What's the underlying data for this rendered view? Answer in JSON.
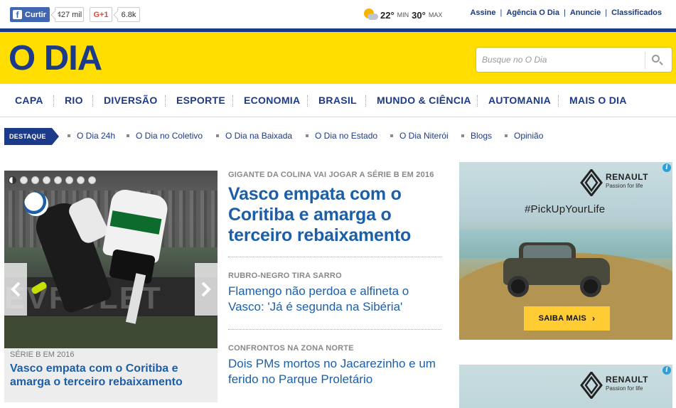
{
  "social": {
    "facebook_label": "Curtir",
    "facebook_count": "427 mil",
    "gplus_label": "G+1",
    "gplus_count": "6.8k"
  },
  "weather": {
    "icon": "partly-cloudy-icon",
    "min_temp": "22°",
    "min_label": "MIN",
    "max_temp": "30°",
    "max_label": "MAX"
  },
  "top_links": [
    "Assine",
    "Agência O Dia",
    "Anuncie",
    "Classificados"
  ],
  "brand": {
    "logo_text": "O DIA",
    "colors": {
      "yellow": "#ffde00",
      "navy": "#1c3a8a",
      "link_blue": "#1c5fa8"
    }
  },
  "search": {
    "placeholder": "Busque no O Dia",
    "value": ""
  },
  "main_nav": [
    "CAPA",
    "RIO",
    "DIVERSÃO",
    "ESPORTE",
    "ECONOMIA",
    "BRASIL",
    "MUNDO & CIÊNCIA",
    "AUTOMANIA",
    "MAIS O DIA"
  ],
  "sub_nav": {
    "badge": "DESTAQUE",
    "items": [
      "O Dia 24h",
      "O Dia no Coletivo",
      "O Dia na Baixada",
      "O Dia no Estado",
      "O Dia Niterói",
      "Blogs",
      "Opinião"
    ]
  },
  "slideshow": {
    "dot_count": 8,
    "active_index": 0,
    "kicker": "SÉRIE B EM 2016",
    "headline": "Vasco empata com o Coritiba e amarga o terceiro rebaixamento"
  },
  "stories": [
    {
      "kicker": "GIGANTE DA COLINA VAI JOGAR A SÉRIE B EM 2016",
      "title": "Vasco empata com o Coritiba e amarga o terceiro rebaixamento"
    },
    {
      "kicker": "RUBRO-NEGRO TIRA SARRO",
      "title": "Flamengo não perdoa e alfineta o Vasco: 'Já é segunda na Sibéria'"
    },
    {
      "kicker": "CONFRONTOS NA ZONA NORTE",
      "title": "Dois PMs mortos no Jacarezinho e um ferido no Parque Proletário"
    }
  ],
  "ads": [
    {
      "brand": "RENAULT",
      "tagline": "Passion for life",
      "hashtag": "#PickUpYourLife",
      "cta": "SAIBA MAIS",
      "cta_color": "#ffcc33"
    },
    {
      "brand": "RENAULT",
      "tagline": "Passion for life"
    }
  ]
}
